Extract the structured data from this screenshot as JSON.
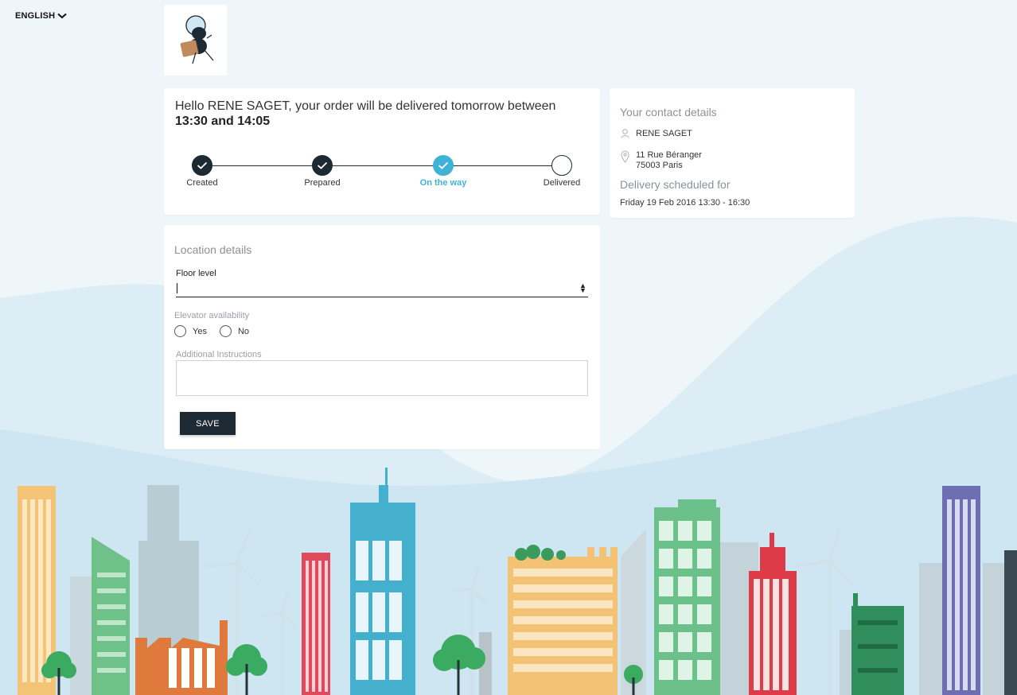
{
  "language": {
    "label": "ENGLISH"
  },
  "status": {
    "greeting_prefix": "Hello RENE SAGET, your order will be delivered tomorrow between ",
    "time_start": "13:30",
    "connector": " and ",
    "time_end": "14:05",
    "steps": [
      {
        "label": "Created",
        "state": "done"
      },
      {
        "label": "Prepared",
        "state": "done"
      },
      {
        "label": "On the way",
        "state": "current"
      },
      {
        "label": "Delivered",
        "state": "todo"
      }
    ]
  },
  "contact": {
    "title": "Your contact details",
    "name": "RENE SAGET",
    "address_line1": "11 Rue Béranger",
    "address_line2": "75003 Paris",
    "delivery_title": "Delivery scheduled for",
    "delivery_slot": "Friday 19 Feb 2016 13:30 - 16:30"
  },
  "location": {
    "title": "Location details",
    "floor_label": "Floor level",
    "floor_value": "",
    "elevator_label": "Elevator availability",
    "elevator_options": [
      "Yes",
      "No"
    ],
    "instructions_label": "Additional Instructions",
    "instructions_value": "",
    "save_label": "SAVE"
  },
  "colors": {
    "primary": "#1d2a33",
    "accent": "#3fb3d6"
  }
}
